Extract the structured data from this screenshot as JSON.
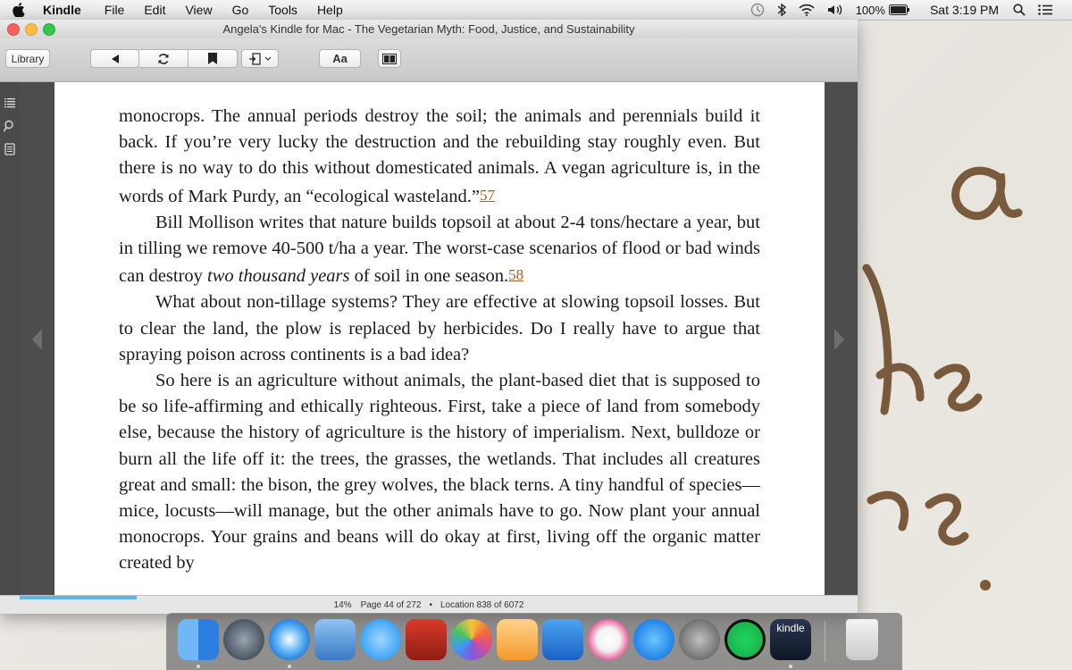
{
  "menubar": {
    "app_name": "Kindle",
    "items": [
      "File",
      "Edit",
      "View",
      "Go",
      "Tools",
      "Help"
    ],
    "battery": "100%",
    "clock": "Sat 3:19 PM"
  },
  "window": {
    "title": "Angela's Kindle for Mac - The Vegetarian Myth: Food, Justice, and Sustainability",
    "library_button": "Library",
    "font_button": "Aa"
  },
  "book": {
    "p1": "monocrops. The annual periods destroy the soil; the animals and perennials build it back. If you’re very lucky the destruction and the rebuilding stay roughly even. But there is no way to do this without domesticated animals. A vegan agriculture is, in the words of Mark Purdy, an “ecological wasteland.”",
    "fn1": "57",
    "p2a": "Bill Mollison writes that nature builds topsoil at about 2-4 tons/hectare a year, but in tilling we remove 40-500 t/ha a year. The worst-case scenarios of flood or bad winds can destroy ",
    "p2em": "two thousand years",
    "p2b": " of soil in one season.",
    "fn2": "58",
    "p3": "What about non-tillage systems? They are effective at slowing topsoil losses. But to clear the land, the plow is replaced by herbicides. Do I really have to argue that spraying poison across continents is a bad idea?",
    "p4": "So here is an agriculture without animals, the plant-based diet that is supposed to be so life-affirming and ethically righteous. First, take a piece of land from somebody else, because the history of agriculture is the history of imperialism. Next, bulldoze or burn all the life off it: the trees, the grasses, the wetlands. That includes all creatures great and small: the bison, the grey wolves, the black terns. A tiny handful of species—mice, locusts—will manage, but the other animals have to go. Now plant your annual monocrops. Your grains and beans will do okay at first, living off the organic matter created by"
  },
  "status": {
    "percent": "14%",
    "page": "Page 44 of 272",
    "separator": "•",
    "location": "Location 838 of 6072",
    "progress_fraction": 0.14
  },
  "dock": {
    "kindle_label": "kindle"
  },
  "colors": {
    "footnote": "#a0602a",
    "progress": "#5fb4e0"
  }
}
